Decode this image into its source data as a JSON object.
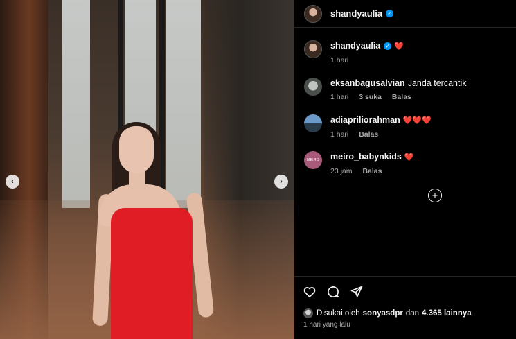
{
  "post": {
    "author": "shandyaulia",
    "prev_icon": "‹",
    "next_icon": "›"
  },
  "comments": [
    {
      "username": "shandyaulia",
      "text": "",
      "emoji": "❤️",
      "time": "1 hari",
      "verified": true
    },
    {
      "username": "eksanbagusalvian",
      "text": "Janda tercantik",
      "time": "1 hari",
      "likes": "3 suka",
      "reply": "Balas"
    },
    {
      "username": "adiapriliorahman",
      "emoji": "❤️❤️❤️",
      "time": "1 hari",
      "reply": "Balas"
    },
    {
      "username": "meiro_babynkids",
      "emoji": "❤️",
      "time": "23 jam",
      "reply": "Balas",
      "avatar_text": "MEIRO"
    }
  ],
  "add_comment_icon": "+",
  "likes": {
    "prefix": "Disukai oleh",
    "user": "sonyasdpr",
    "conj": "dan",
    "count": "4.365 lainnya"
  },
  "posted": "1 hari yang lalu",
  "colors": {
    "background": "#000000",
    "verified": "#0095f6",
    "heart": "#ff3040",
    "muted": "#a8a8a8"
  }
}
